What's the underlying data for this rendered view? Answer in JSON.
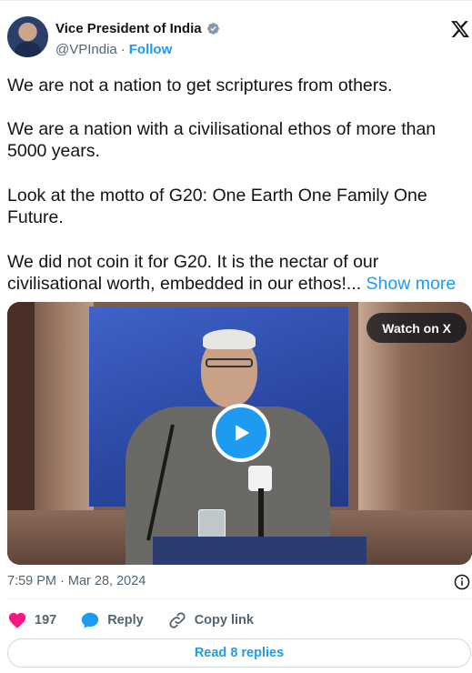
{
  "author": {
    "name": "Vice President of India",
    "handle": "@VPIndia",
    "separator": "·",
    "follow_label": "Follow"
  },
  "tweet": {
    "paragraphs": [
      "We are not a nation to get scriptures from others.",
      "We are a nation with a civilisational ethos of more than 5000 years.",
      "Look at the motto of G20: One Earth One Family One Future.",
      "We did not coin it for G20. It is the nectar of our civilisational worth, embedded in our ethos!..."
    ],
    "show_more_label": "Show more"
  },
  "media": {
    "watch_label": "Watch on X"
  },
  "meta": {
    "timestamp": "7:59 PM · Mar 28, 2024"
  },
  "actions": {
    "like_count": "197",
    "reply_label": "Reply",
    "copy_link_label": "Copy link"
  },
  "read_replies_label": "Read 8 replies",
  "colors": {
    "accent": "#1d9bf0",
    "like": "#f91880",
    "text": "#0f1419",
    "secondary": "#536471"
  },
  "icons": {
    "verified": "verified-badge-icon",
    "logo": "x-logo-icon",
    "play": "play-icon",
    "info": "info-icon",
    "like": "heart-icon",
    "reply": "speech-bubble-icon",
    "copy": "link-icon"
  }
}
